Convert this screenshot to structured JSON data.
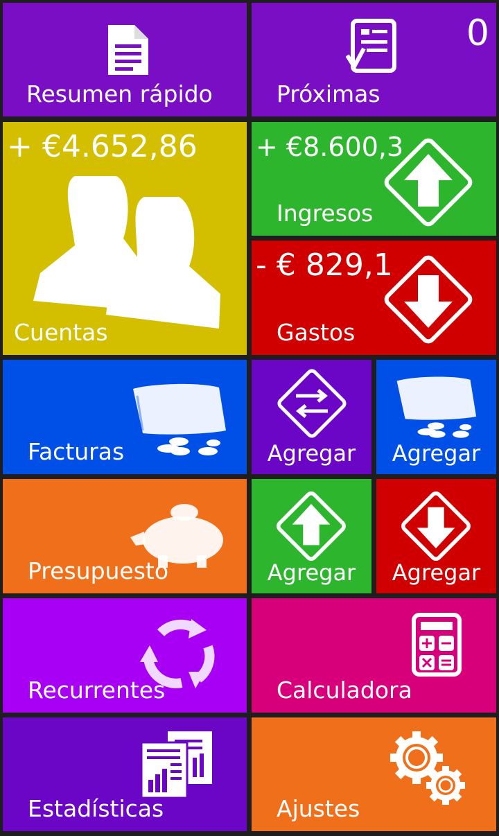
{
  "colors": {
    "purple": "#7a0ec4",
    "yellow": "#d4be00",
    "green": "#2eb52e",
    "red": "#d00000",
    "blue": "#0050e8",
    "orange": "#ef6f1a",
    "violet": "#a800f5",
    "magenta": "#d8007a",
    "dark_purple": "#6c06c7"
  },
  "tiles": {
    "resumen": {
      "label": "Resumen rápido",
      "icon": "document-icon"
    },
    "proximas": {
      "label": "Próximas",
      "count": "0",
      "icon": "checklist-icon"
    },
    "cuentas": {
      "label": "Cuentas",
      "amount": "+ €4.652,86",
      "icon": "people-icon"
    },
    "ingresos": {
      "label": "Ingresos",
      "amount": "+ €8.600,3",
      "icon": "arrow-up-diamond-icon"
    },
    "gastos": {
      "label": "Gastos",
      "amount": "- € 829,1",
      "icon": "arrow-down-diamond-icon"
    },
    "facturas": {
      "label": "Facturas",
      "icon": "wallet-coins-icon"
    },
    "agregar_transfer": {
      "label": "Agregar",
      "icon": "transfer-diamond-icon"
    },
    "agregar_factura": {
      "label": "Agregar",
      "icon": "wallet-coins-icon"
    },
    "presupuesto": {
      "label": "Presupuesto",
      "icon": "piggy-bank-icon"
    },
    "agregar_ingreso": {
      "label": "Agregar",
      "icon": "arrow-up-diamond-icon"
    },
    "agregar_gasto": {
      "label": "Agregar",
      "icon": "arrow-down-diamond-icon"
    },
    "recurrentes": {
      "label": "Recurrentes",
      "icon": "recurring-cycle-icon"
    },
    "calculadora": {
      "label": "Calculadora",
      "icon": "calculator-icon"
    },
    "estadisticas": {
      "label": "Estadísticas",
      "icon": "statistics-report-icon"
    },
    "ajustes": {
      "label": "Ajustes",
      "icon": "gears-icon"
    }
  }
}
